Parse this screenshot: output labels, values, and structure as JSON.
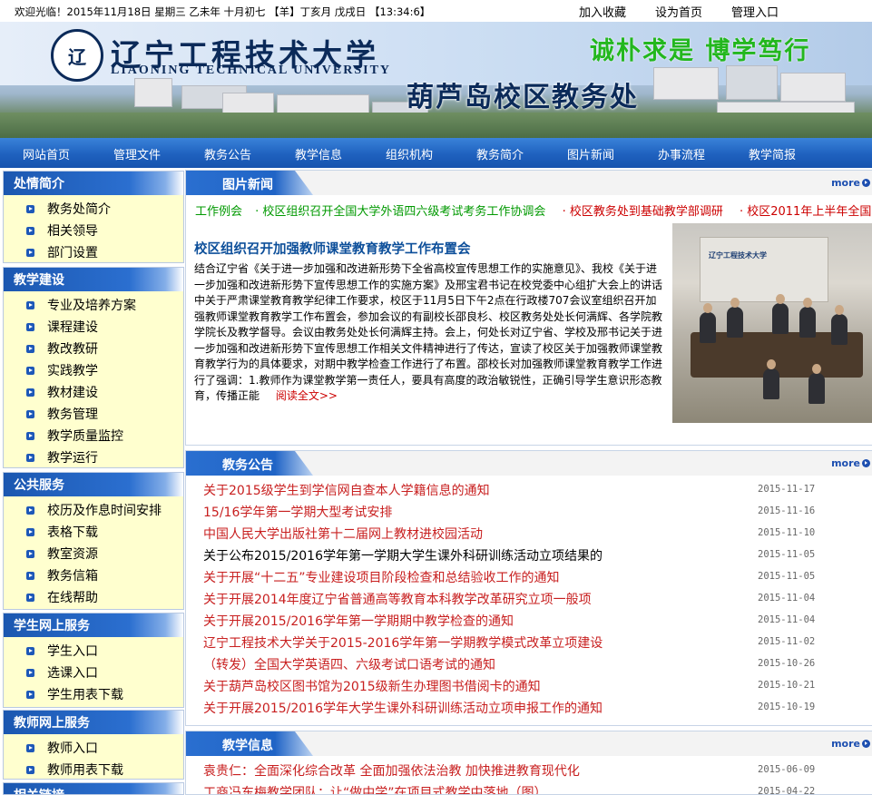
{
  "topbar": {
    "welcome": "欢迎光临！2015年11月18日 星期三  乙未年 十月初七 【羊】丁亥月 戊戌日 【13:34:6】",
    "links": [
      "加入收藏",
      "设为首页",
      "管理入口"
    ]
  },
  "banner": {
    "logo_text": "辽",
    "university_cn": "辽宁工程技术大学",
    "university_en": "LIAONING TECHNICAL UNIVERSITY",
    "motto": "诚朴求是  博学笃行",
    "campus_title": "葫芦岛校区教务处"
  },
  "nav": [
    "网站首页",
    "管理文件",
    "教务公告",
    "教学信息",
    "组织机构",
    "教务简介",
    "图片新闻",
    "办事流程",
    "教学简报"
  ],
  "sidebar": [
    {
      "title": "处情简介",
      "items": [
        "教务处简介",
        "相关领导",
        "部门设置"
      ]
    },
    {
      "title": "教学建设",
      "items": [
        "专业及培养方案",
        "课程建设",
        "教改教研",
        "实践教学",
        "教材建设",
        "教务管理",
        "教学质量监控",
        "教学运行"
      ]
    },
    {
      "title": "公共服务",
      "items": [
        "校历及作息时间安排",
        "表格下载",
        "教室资源",
        "教务信箱",
        "在线帮助"
      ]
    },
    {
      "title": "学生网上服务",
      "items": [
        "学生入口",
        "选课入口",
        "学生用表下载"
      ]
    },
    {
      "title": "教师网上服务",
      "items": [
        "教师入口",
        "教师用表下载"
      ]
    },
    {
      "title": "相关链接",
      "items": []
    }
  ],
  "picture_news": {
    "title": "图片新闻",
    "more": "more",
    "marquee": [
      {
        "text": "工作例会",
        "color": "#009900"
      },
      {
        "text": "· 校区组织召开全国大学外语四六级考试考务工作协调会",
        "color": "#009900"
      },
      {
        "text": "· 校区教务处到基础教学部调研",
        "color": "#cc0000"
      },
      {
        "text": "· 校区2011年上半年全国",
        "color": "#cc0000"
      }
    ],
    "headline": "校区组织召开加强教师课堂教育教学工作布置会",
    "body": "结合辽宁省《关于进一步加强和改进新形势下全省高校宣传思想工作的实施意见》、我校《关于进一步加强和改进新形势下宣传思想工作的实施方案》及邢宝君书记在校党委中心组扩大会上的讲话中关于严肃课堂教育教学纪律工作要求，校区于11月5日下午2点在行政楼707会议室组织召开加强教师课堂教育教学工作布置会，参加会议的有副校长邵良杉、校区教务处处长何满辉、各学院教学院长及教学督导。会议由教务处处长何满辉主持。会上，何处长对辽宁省、学校及邢书记关于进一步加强和改进新形势下宣传思想工作相关文件精神进行了传达，宣读了校区关于加强教师课堂教育教学行为的具体要求，对期中教学检查工作进行了布置。邵校长对加强教师课堂教育教学工作进行了强调：1.教师作为课堂教学第一责任人，要具有高度的政治敏锐性，正确引导学生意识形态教育，传播正能",
    "read_more": "阅读全文>>",
    "photo_caption": "辽宁工程技术大学"
  },
  "notices": {
    "title": "教务公告",
    "more": "more",
    "items": [
      {
        "text": "关于2015级学生到学信网自查本人学籍信息的通知",
        "date": "2015-11-17",
        "color": "red"
      },
      {
        "text": "15/16学年第一学期大型考试安排",
        "date": "2015-11-16",
        "color": "red"
      },
      {
        "text": "中国人民大学出版社第十二届网上教材进校园活动",
        "date": "2015-11-10",
        "color": "red"
      },
      {
        "text": "关于公布2015/2016学年第一学期大学生课外科研训练活动立项结果的",
        "date": "2015-11-05",
        "color": "black"
      },
      {
        "text": "关于开展“十二五”专业建设项目阶段检查和总结验收工作的通知",
        "date": "2015-11-05",
        "color": "red"
      },
      {
        "text": "关于开展2014年度辽宁省普通高等教育本科教学改革研究立项一般项",
        "date": "2015-11-04",
        "color": "red"
      },
      {
        "text": "关于开展2015/2016学年第一学期期中教学检查的通知",
        "date": "2015-11-04",
        "color": "red"
      },
      {
        "text": "辽宁工程技术大学关于2015-2016学年第一学期教学模式改革立项建设",
        "date": "2015-11-02",
        "color": "red"
      },
      {
        "text": "（转发）全国大学英语四、六级考试口语考试的通知",
        "date": "2015-10-26",
        "color": "red"
      },
      {
        "text": "关于葫芦岛校区图书馆为2015级新生办理图书借阅卡的通知",
        "date": "2015-10-21",
        "color": "red"
      },
      {
        "text": "关于开展2015/2016学年大学生课外科研训练活动立项申报工作的通知",
        "date": "2015-10-19",
        "color": "red"
      }
    ]
  },
  "teaching_info": {
    "title": "教学信息",
    "more": "more",
    "items": [
      {
        "text": "袁贵仁：全面深化综合改革 全面加强依法治教 加快推进教育现代化",
        "date": "2015-06-09",
        "color": "red"
      },
      {
        "text": "工商冯东梅教学团队：让“做中学”在项目式教学中落地（图）",
        "date": "2015-04-22",
        "color": "red"
      }
    ]
  }
}
